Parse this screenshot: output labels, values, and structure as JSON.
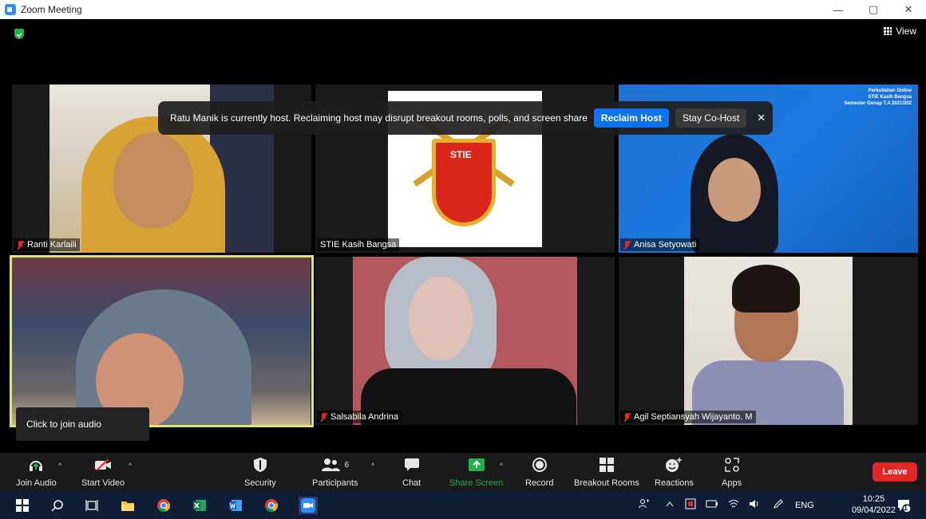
{
  "window": {
    "title": "Zoom Meeting",
    "minimize": "—",
    "restore": "▢",
    "close": "✕"
  },
  "meeting": {
    "view_label": "View"
  },
  "banner": {
    "message": "Ratu Manik is currently host. Reclaiming host may disrupt breakout rooms, polls, and screen share",
    "reclaim_label": "Reclaim Host",
    "stay_label": "Stay Co-Host",
    "close_glyph": "✕"
  },
  "participants": [
    {
      "name": "Ranti Karlaili",
      "muted": true
    },
    {
      "name": "STIE Kasih Bangsa",
      "muted": false
    },
    {
      "name": "Anisa Setyowati",
      "muted": true
    },
    {
      "name": "",
      "muted": false
    },
    {
      "name": "Salsabila Andrina",
      "muted": true
    },
    {
      "name": "Agil Septiansyah Wijayanto. M",
      "muted": true
    }
  ],
  "slide_banner": {
    "line1": "Perkuliahan Online",
    "line2": "STIE Kasih Bangsa",
    "line3": "Semester Genap T.A 2021/202"
  },
  "logo_text": "STIE",
  "tooltip": "Click to join audio",
  "controls": {
    "join_audio": "Join Audio",
    "start_video": "Start Video",
    "security": "Security",
    "participants": "Participants",
    "participants_count": "6",
    "chat": "Chat",
    "share_screen": "Share Screen",
    "record": "Record",
    "breakout_rooms": "Breakout Rooms",
    "reactions": "Reactions",
    "apps": "Apps",
    "leave": "Leave",
    "caret": "^"
  },
  "taskbar": {
    "language": "ENG",
    "time": "10:25",
    "date": "09/04/2022",
    "notification_count": "1"
  },
  "colors": {
    "accent": "#0e72ed",
    "share_green": "#23b14d",
    "leave_red": "#e02828",
    "active_speaker": "#d8e67a"
  }
}
